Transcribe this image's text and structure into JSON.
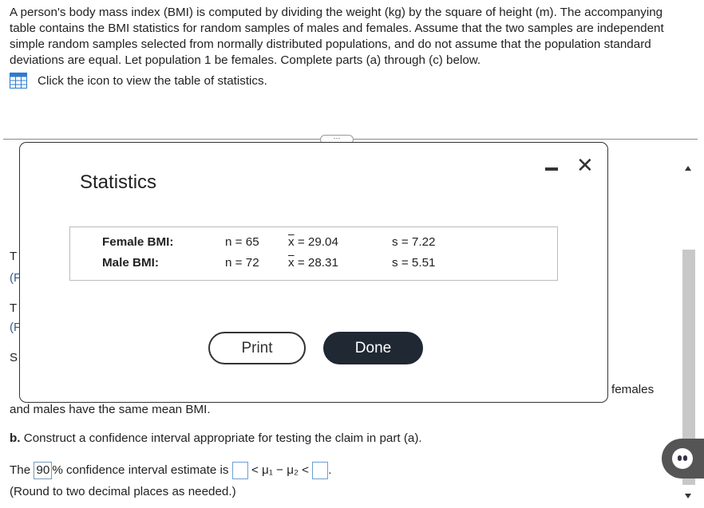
{
  "problem": {
    "text": "A person's body mass index (BMI) is computed by dividing the weight (kg) by the square of height (m). The accompanying table contains the BMI statistics for random samples of males and females. Assume that the two samples are independent simple random samples selected from normally distributed populations, and do not assume that the population standard deviations are equal. Let population 1 be females. Complete parts (a) through (c) below.",
    "table_link": "Click the icon to view the table of statistics."
  },
  "background": {
    "frag_t1": "T",
    "frag_p1": "(F",
    "frag_t2": "T",
    "frag_p2": "(F",
    "frag_s": "S",
    "right_word": "females",
    "part_a_tail": "and males have the same mean BMI.",
    "part_b_label": "b.",
    "part_b_text": "Construct a confidence interval appropriate for testing the claim in part (a).",
    "ci_prefix": "The",
    "ci_level": "90",
    "ci_mid": "% confidence interval estimate is",
    "ci_expr": "< μ₁ − μ₂ <",
    "round_note": "(Round to two decimal places as needed.)"
  },
  "modal": {
    "title": "Statistics",
    "rows": [
      {
        "label": "Female BMI:",
        "n": "n = 65",
        "xbar_sym": "x",
        "xbar_val": " = 29.04",
        "s": "s = 7.22"
      },
      {
        "label": "Male BMI:",
        "n": "n = 72",
        "xbar_sym": "x",
        "xbar_val": " = 28.31",
        "s": "s = 5.51"
      }
    ],
    "print_label": "Print",
    "done_label": "Done",
    "close_glyph": "✕"
  },
  "icons": [
    "table-grid-icon",
    "minimize-icon",
    "close-icon",
    "scroll-up-icon",
    "scroll-down-icon",
    "assistant-icon"
  ],
  "colors": {
    "done_button": "#1f2833",
    "link_text": "#3a5a8a",
    "answer_box_border": "#6aa0d0"
  }
}
